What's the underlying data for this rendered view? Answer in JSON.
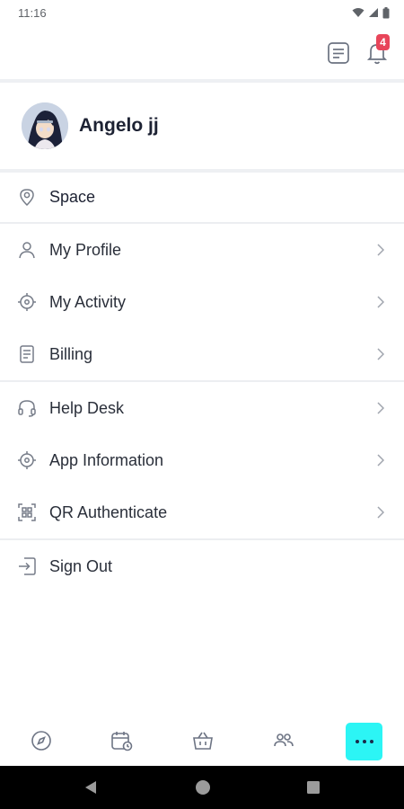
{
  "status_bar": {
    "time": "11:16"
  },
  "header": {
    "notification_count": "4"
  },
  "profile": {
    "name": "Angelo jj"
  },
  "menu": {
    "space": "Space",
    "my_profile": "My Profile",
    "my_activity": "My Activity",
    "billing": "Billing",
    "help_desk": "Help Desk",
    "app_information": "App Information",
    "qr_authenticate": "QR Authenticate",
    "sign_out": "Sign Out"
  },
  "bottom_nav": {
    "items": [
      "compass-icon",
      "calendar-clock-icon",
      "basket-icon",
      "people-icon",
      "more-icon"
    ],
    "active": "more",
    "accent_color": "#2cf5f5"
  },
  "colors": {
    "badge": "#e8455a",
    "text": "#1f2430",
    "icon": "#7a808c"
  }
}
